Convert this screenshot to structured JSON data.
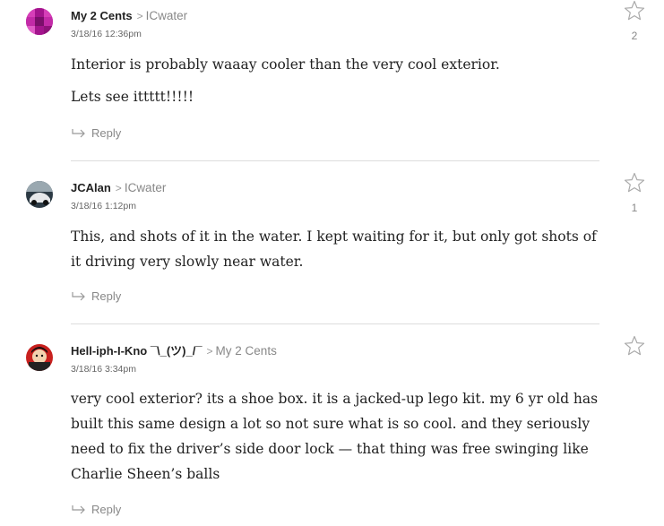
{
  "comments": [
    {
      "author": "My 2 Cents",
      "reply_to": "ICwater",
      "timestamp": "3/18/16 12:36pm",
      "paragraphs": [
        "Interior is probably waaay cooler than the very cool exterior.",
        "Lets see ittttt!!!!!"
      ],
      "reply_label": "Reply",
      "star_count": "2",
      "avatar_icon": "pixel-avatar-magenta"
    },
    {
      "author": "JCAlan",
      "reply_to": "ICwater",
      "timestamp": "3/18/16 1:12pm",
      "paragraphs": [
        "This, and shots of it in the water. I kept waiting for it, but only got shots of it driving very slowly near water."
      ],
      "reply_label": "Reply",
      "star_count": "1",
      "avatar_icon": "photo-avatar-car"
    },
    {
      "author": "Hell-iph-I-Kno ¯\\_(ツ)_/¯",
      "reply_to": "My 2 Cents",
      "timestamp": "3/18/16 3:34pm",
      "paragraphs": [
        "very cool exterior? its a shoe box. it is a jacked-up lego kit. my 6 yr old has built this same design a lot so not sure what is so cool. and they seriously need to fix the driver’s side door lock — that thing was free swinging like Charlie Sheen’s balls"
      ],
      "reply_label": "Reply",
      "star_count": "",
      "avatar_icon": "cartoon-avatar-red"
    }
  ],
  "colors": {
    "muted": "#888888",
    "divider": "#dddddd",
    "text": "#222222"
  },
  "icons": {
    "star": "star-outline-icon",
    "reply": "reply-arrow-icon",
    "separator": "chevron-right"
  }
}
